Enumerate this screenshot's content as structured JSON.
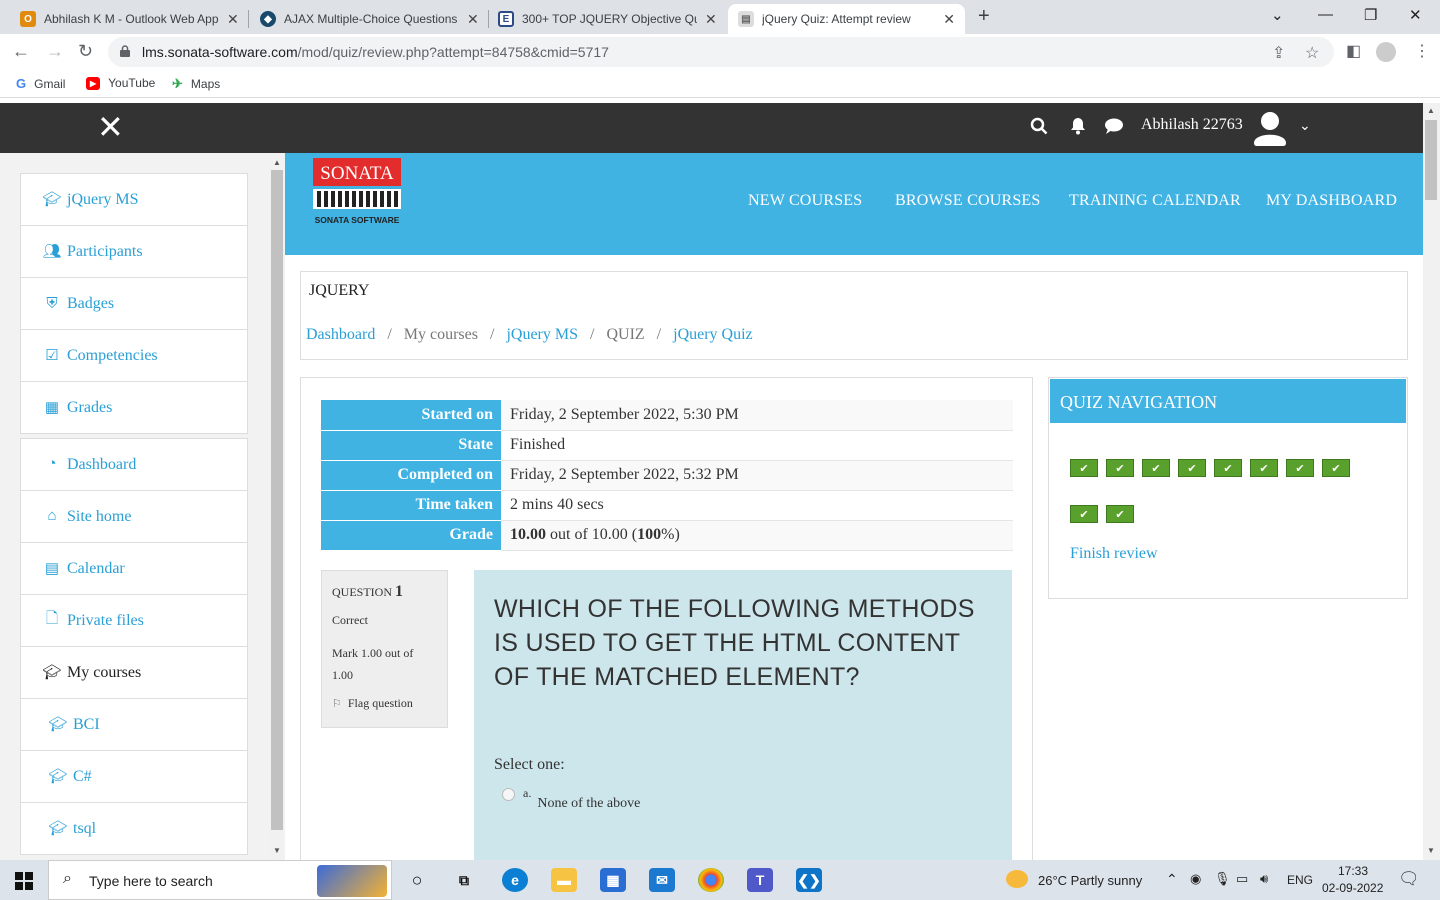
{
  "browser": {
    "tabs": [
      {
        "title": "Abhilash K M - Outlook Web App",
        "color": "#e08a0e",
        "glyph": "O"
      },
      {
        "title": "AJAX Multiple-Choice Questions",
        "color": "#1a4a6b",
        "glyph": "◆"
      },
      {
        "title": "300+ TOP JQUERY Objective Que",
        "color": "#2b4a86",
        "glyph": "E"
      },
      {
        "title": "jQuery Quiz: Attempt review",
        "color": "#888888",
        "glyph": "▤"
      }
    ],
    "url_host": "lms.sonata-software.com",
    "url_path": "/mod/quiz/review.php?attempt=84758&cmid=5717",
    "bookmarks": [
      "Gmail",
      "YouTube",
      "Maps"
    ]
  },
  "site": {
    "username": "Abhilash 22763",
    "logo_text": "SONATA",
    "logo_sub": "SONATA SOFTWARE",
    "nav": [
      "NEW COURSES",
      "BROWSE COURSES",
      "TRAINING CALENDAR",
      "MY DASHBOARD"
    ]
  },
  "drawer": {
    "items": [
      {
        "label": "jQuery MS",
        "icon": "graduation-cap-icon"
      },
      {
        "label": "Participants",
        "icon": "users-icon"
      },
      {
        "label": "Badges",
        "icon": "shield-icon"
      },
      {
        "label": "Competencies",
        "icon": "check-square-icon"
      },
      {
        "label": "Grades",
        "icon": "table-icon"
      },
      {
        "label": "Dashboard",
        "icon": "tachometer-icon"
      },
      {
        "label": "Site home",
        "icon": "home-icon"
      },
      {
        "label": "Calendar",
        "icon": "calendar-icon"
      },
      {
        "label": "Private files",
        "icon": "file-icon"
      },
      {
        "label": "My courses",
        "icon": "graduation-cap-icon"
      },
      {
        "label": "BCI",
        "icon": "graduation-cap-icon"
      },
      {
        "label": "C#",
        "icon": "graduation-cap-icon"
      },
      {
        "label": "tsql",
        "icon": "graduation-cap-icon"
      }
    ]
  },
  "page": {
    "heading": "JQUERY",
    "breadcrumb": [
      "Dashboard",
      "My courses",
      "jQuery MS",
      "QUIZ",
      "jQuery Quiz"
    ]
  },
  "summary": {
    "rows": [
      {
        "label": "Started on",
        "value": "Friday, 2 September 2022, 5:30 PM"
      },
      {
        "label": "State",
        "value": "Finished"
      },
      {
        "label": "Completed on",
        "value": "Friday, 2 September 2022, 5:32 PM"
      },
      {
        "label": "Time taken",
        "value": "2 mins 40 secs"
      },
      {
        "label": "Grade",
        "value_bold1": "10.00",
        "value_mid": " out of 10.00 (",
        "value_bold2": "100",
        "value_end": "%)"
      }
    ]
  },
  "question": {
    "label": "QUESTION",
    "number": "1",
    "state": "Correct",
    "mark": "Mark 1.00 out of 1.00",
    "flag": "Flag question",
    "text": "WHICH OF THE FOLLOWING METHODS IS USED TO GET THE HTML CONTENT OF THE MATCHED ELEMENT?",
    "prompt": "Select one:",
    "options": [
      {
        "letter": "a.",
        "text": "None of the above"
      }
    ]
  },
  "quiz_nav": {
    "title": "QUIZ NAVIGATION",
    "question_count": 10,
    "finish": "Finish review"
  },
  "taskbar": {
    "search_placeholder": "Type here to search",
    "weather": "26°C  Partly sunny",
    "lang": "ENG",
    "time": "17:33",
    "date": "02-09-2022"
  }
}
